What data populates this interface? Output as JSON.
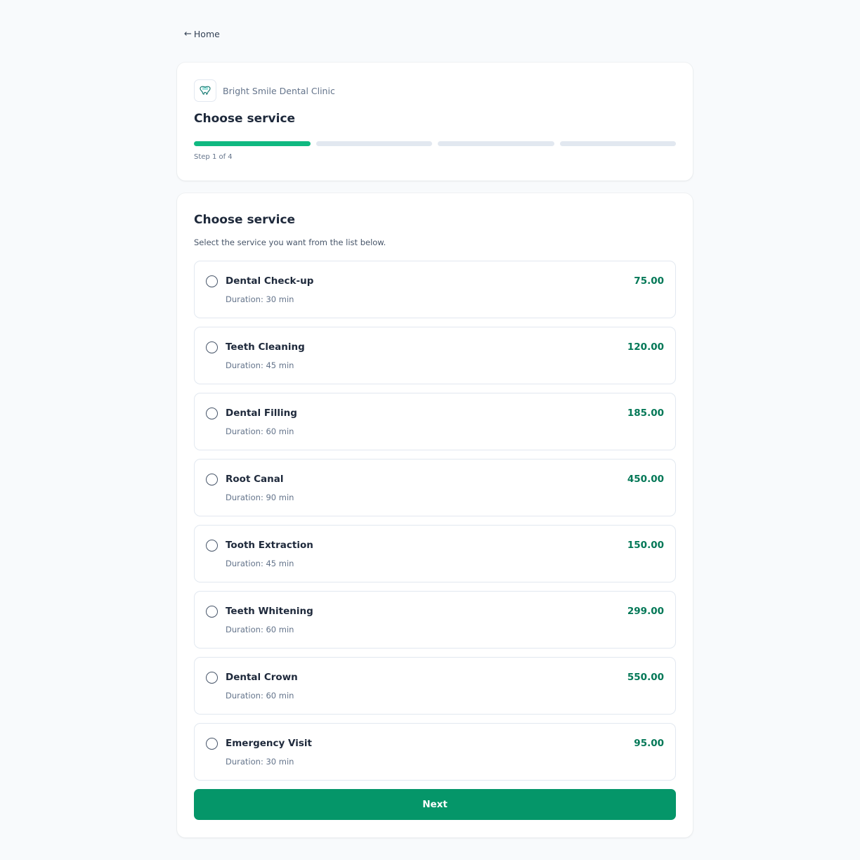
{
  "nav": {
    "home_label": "Home"
  },
  "header": {
    "clinic_name": "Bright Smile Dental Clinic",
    "title": "Choose service",
    "step_text": "Step 1 of 4",
    "steps_total": 4,
    "step_current": 1
  },
  "main": {
    "title": "Choose service",
    "subtitle": "Select the service you want from the list below.",
    "services": [
      {
        "name": "Dental Check-up",
        "duration": "Duration: 30 min",
        "price": "75.00"
      },
      {
        "name": "Teeth Cleaning",
        "duration": "Duration: 45 min",
        "price": "120.00"
      },
      {
        "name": "Dental Filling",
        "duration": "Duration: 60 min",
        "price": "185.00"
      },
      {
        "name": "Root Canal",
        "duration": "Duration: 90 min",
        "price": "450.00"
      },
      {
        "name": "Tooth Extraction",
        "duration": "Duration: 45 min",
        "price": "150.00"
      },
      {
        "name": "Teeth Whitening",
        "duration": "Duration: 60 min",
        "price": "299.00"
      },
      {
        "name": "Dental Crown",
        "duration": "Duration: 60 min",
        "price": "550.00"
      },
      {
        "name": "Emergency Visit",
        "duration": "Duration: 30 min",
        "price": "95.00"
      }
    ],
    "next_label": "Next"
  },
  "colors": {
    "accent": "#10b981",
    "button": "#059669",
    "price": "#047857",
    "background": "#f8fafc"
  },
  "icons": {
    "home_arrow": "arrow-left-icon",
    "clinic_logo": "tooth-logo-icon"
  }
}
